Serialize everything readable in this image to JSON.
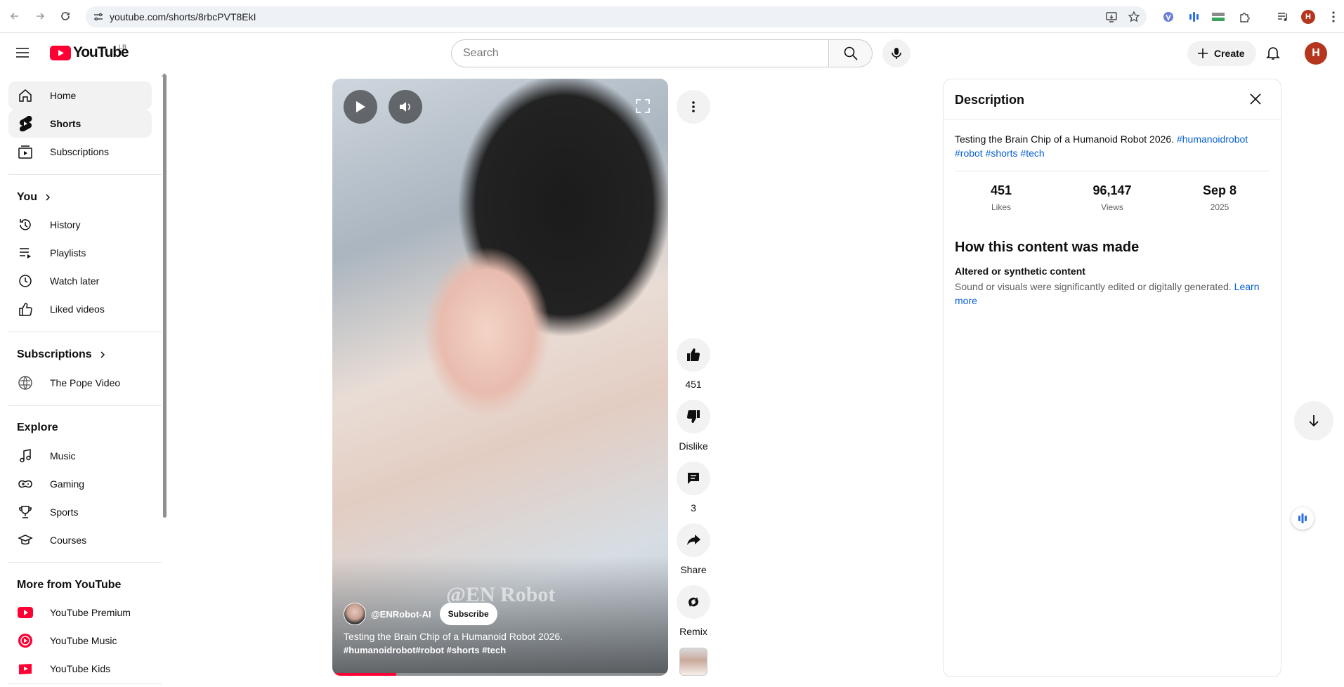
{
  "browser": {
    "url": "youtube.com/shorts/8rbcPVT8EkI",
    "back_icon": "arrow-left-icon",
    "forward_icon": "arrow-right-icon",
    "reload_icon": "reload-icon",
    "profile_initial": "H"
  },
  "header": {
    "logo_text": "YouTube",
    "country_code": "LB",
    "search_placeholder": "Search",
    "create_label": "Create",
    "avatar_initial": "H"
  },
  "sidebar": {
    "main": [
      {
        "label": "Home",
        "icon": "home-icon"
      },
      {
        "label": "Shorts",
        "icon": "shorts-icon",
        "active": true
      },
      {
        "label": "Subscriptions",
        "icon": "subscriptions-icon"
      }
    ],
    "you_heading": "You",
    "you": [
      {
        "label": "History",
        "icon": "history-icon"
      },
      {
        "label": "Playlists",
        "icon": "playlists-icon"
      },
      {
        "label": "Watch later",
        "icon": "clock-icon"
      },
      {
        "label": "Liked videos",
        "icon": "thumb-up-icon"
      }
    ],
    "subs_heading": "Subscriptions",
    "subs": [
      {
        "label": "The Pope Video",
        "icon": "channel-avatar-icon"
      }
    ],
    "explore_heading": "Explore",
    "explore": [
      {
        "label": "Music",
        "icon": "music-icon"
      },
      {
        "label": "Gaming",
        "icon": "gaming-icon"
      },
      {
        "label": "Sports",
        "icon": "trophy-icon"
      },
      {
        "label": "Courses",
        "icon": "courses-icon"
      }
    ],
    "more_heading": "More from YouTube",
    "more": [
      {
        "label": "YouTube Premium",
        "icon": "youtube-premium-icon"
      },
      {
        "label": "YouTube Music",
        "icon": "youtube-music-icon"
      },
      {
        "label": "YouTube Kids",
        "icon": "youtube-kids-icon"
      }
    ]
  },
  "video": {
    "watermark": "@EN Robot",
    "channel": "@ENRobot-AI",
    "subscribe_label": "Subscribe",
    "title": "Testing the Brain Chip of a Humanoid Robot 2026.",
    "tags": "#humanoidrobot#robot #shorts #tech",
    "progress": 0.19
  },
  "actions": {
    "likes": "451",
    "dislike": "Dislike",
    "comments": "3",
    "share": "Share",
    "remix": "Remix"
  },
  "description": {
    "title": "Description",
    "text": "Testing the Brain Chip of a Humanoid Robot 2026.",
    "hashtags": [
      "#humanoidrobot",
      "#robot",
      "#shorts",
      "#tech"
    ],
    "stats": [
      {
        "value": "451",
        "label": "Likes"
      },
      {
        "value": "96,147",
        "label": "Views"
      },
      {
        "value": "Sep 8",
        "label": "2025"
      }
    ],
    "how_title": "How this content was made",
    "altered_title": "Altered or synthetic content",
    "altered_text": "Sound or visuals were significantly edited or digitally generated.",
    "learn_more": "Learn more"
  },
  "colors": {
    "brand_red": "#ff0033",
    "link_blue": "#065fd4",
    "avatar_bg": "#b5361e"
  }
}
